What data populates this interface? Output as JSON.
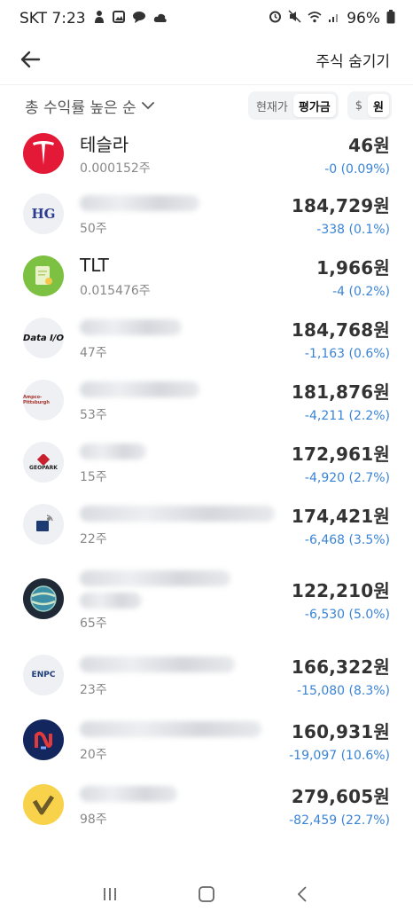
{
  "status": {
    "carrier_time": "SKT 7:23",
    "battery": "96%"
  },
  "header": {
    "hide_label": "주식 숨기기"
  },
  "controls": {
    "sort_label": "총 수익률 높은 순",
    "price_mode": [
      "현재가",
      "평가금"
    ],
    "currency": [
      "$",
      "원"
    ]
  },
  "stocks": [
    {
      "name": "테슬라",
      "qty": "0.000152주",
      "value": "46원",
      "change": "-0 (0.09%)",
      "logo_icon": "tesla-logo"
    },
    {
      "name": "",
      "qty": "50주",
      "value": "184,729원",
      "change": "-338 (0.1%)",
      "logo_icon": "hg-logo"
    },
    {
      "name": "TLT",
      "qty": "0.015476주",
      "value": "1,966원",
      "change": "-4 (0.2%)",
      "logo_icon": "tlt-logo"
    },
    {
      "name": "",
      "qty": "47주",
      "value": "184,768원",
      "change": "-1,163 (0.6%)",
      "logo_icon": "data-io-logo"
    },
    {
      "name": "",
      "qty": "53주",
      "value": "181,876원",
      "change": "-4,211 (2.2%)",
      "logo_icon": "ampco-logo"
    },
    {
      "name": "",
      "qty": "15주",
      "value": "172,961원",
      "change": "-4,920 (2.7%)",
      "logo_icon": "geopark-logo"
    },
    {
      "name": "",
      "qty": "22주",
      "value": "174,421원",
      "change": "-6,468 (3.5%)",
      "logo_icon": "satellite-logo"
    },
    {
      "name": "",
      "qty": "65주",
      "value": "122,210원",
      "change": "-6,530 (5.0%)",
      "logo_icon": "globe-logo"
    },
    {
      "name": "",
      "qty": "23주",
      "value": "166,322원",
      "change": "-15,080 (8.3%)",
      "logo_icon": "enpc-logo"
    },
    {
      "name": "",
      "qty": "20주",
      "value": "160,931원",
      "change": "-19,097 (10.6%)",
      "logo_icon": "blue-red-logo"
    },
    {
      "name": "",
      "qty": "98주",
      "value": "279,605원",
      "change": "-82,459 (22.7%)",
      "logo_icon": "checkmark-logo"
    }
  ],
  "logo_text": {
    "hg": "HG",
    "data_io": "Data I/O",
    "ampco": "Ampco-Pittsburgh",
    "geopark": "GEOPARK",
    "enpc": "ENPC"
  },
  "colors": {
    "accent_blue": "#3a84d6",
    "tesla_red": "#e31937",
    "tlt_green": "#7dc142"
  }
}
